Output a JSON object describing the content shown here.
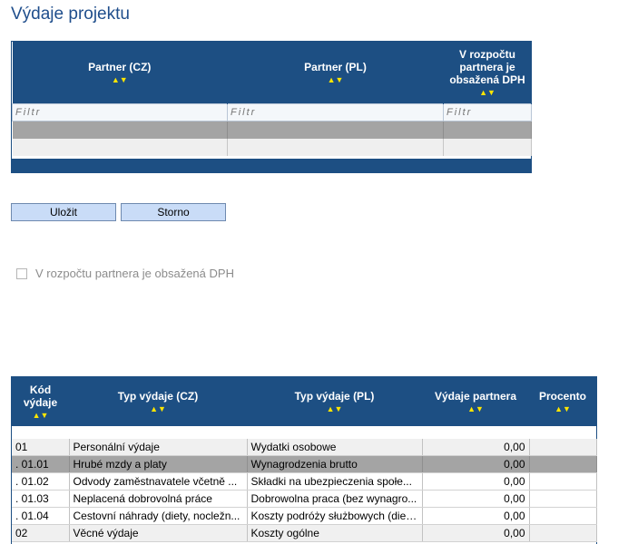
{
  "page": {
    "title": "Výdaje projektu"
  },
  "partner_grid": {
    "columns": [
      {
        "label": "Partner (CZ)"
      },
      {
        "label": "Partner (PL)"
      },
      {
        "label": "V rozpočtu partnera je obsažená DPH"
      }
    ],
    "filter_placeholder": "Filtr"
  },
  "buttons": {
    "save": "Uložit",
    "cancel": "Storno"
  },
  "vat_checkbox": {
    "label": "V rozpočtu partnera je obsažená DPH",
    "checked": false
  },
  "expense_grid": {
    "columns": [
      {
        "label": "Kód výdaje"
      },
      {
        "label": "Typ výdaje (CZ)"
      },
      {
        "label": "Typ výdaje (PL)"
      },
      {
        "label": "Výdaje partnera"
      },
      {
        "label": "Procento"
      }
    ],
    "rows": [
      {
        "code": "01",
        "type_cz": "Personální výdaje",
        "type_pl": "Wydatki osobowe",
        "amount": "0,00",
        "percent": ""
      },
      {
        "code": ". 01.01",
        "type_cz": "Hrubé mzdy a platy",
        "type_pl": "Wynagrodzenia brutto",
        "amount": "0,00",
        "percent": ""
      },
      {
        "code": ". 01.02",
        "type_cz": "Odvody zaměstnavatele včetně ...",
        "type_pl": "Składki na ubezpieczenia społe...",
        "amount": "0,00",
        "percent": ""
      },
      {
        "code": ". 01.03",
        "type_cz": "Neplacená dobrovolná práce",
        "type_pl": "Dobrowolna praca (bez wynagro...",
        "amount": "0,00",
        "percent": ""
      },
      {
        "code": ". 01.04",
        "type_cz": "Cestovní náhrady (diety, nocležn...",
        "type_pl": "Koszty podróży służbowych (diet...",
        "amount": "0,00",
        "percent": ""
      },
      {
        "code": "02",
        "type_cz": "Věcné výdaje",
        "type_pl": "Koszty ogólne",
        "amount": "0,00",
        "percent": ""
      }
    ]
  },
  "icons": {
    "sort": "sort-up-down-icon"
  },
  "colors": {
    "header_bg": "#1d4f83",
    "title": "#1f4e8c",
    "sort_arrows": "#ffe600",
    "button_bg": "#c9dcf7",
    "selected_row": "#a4a4a4"
  }
}
